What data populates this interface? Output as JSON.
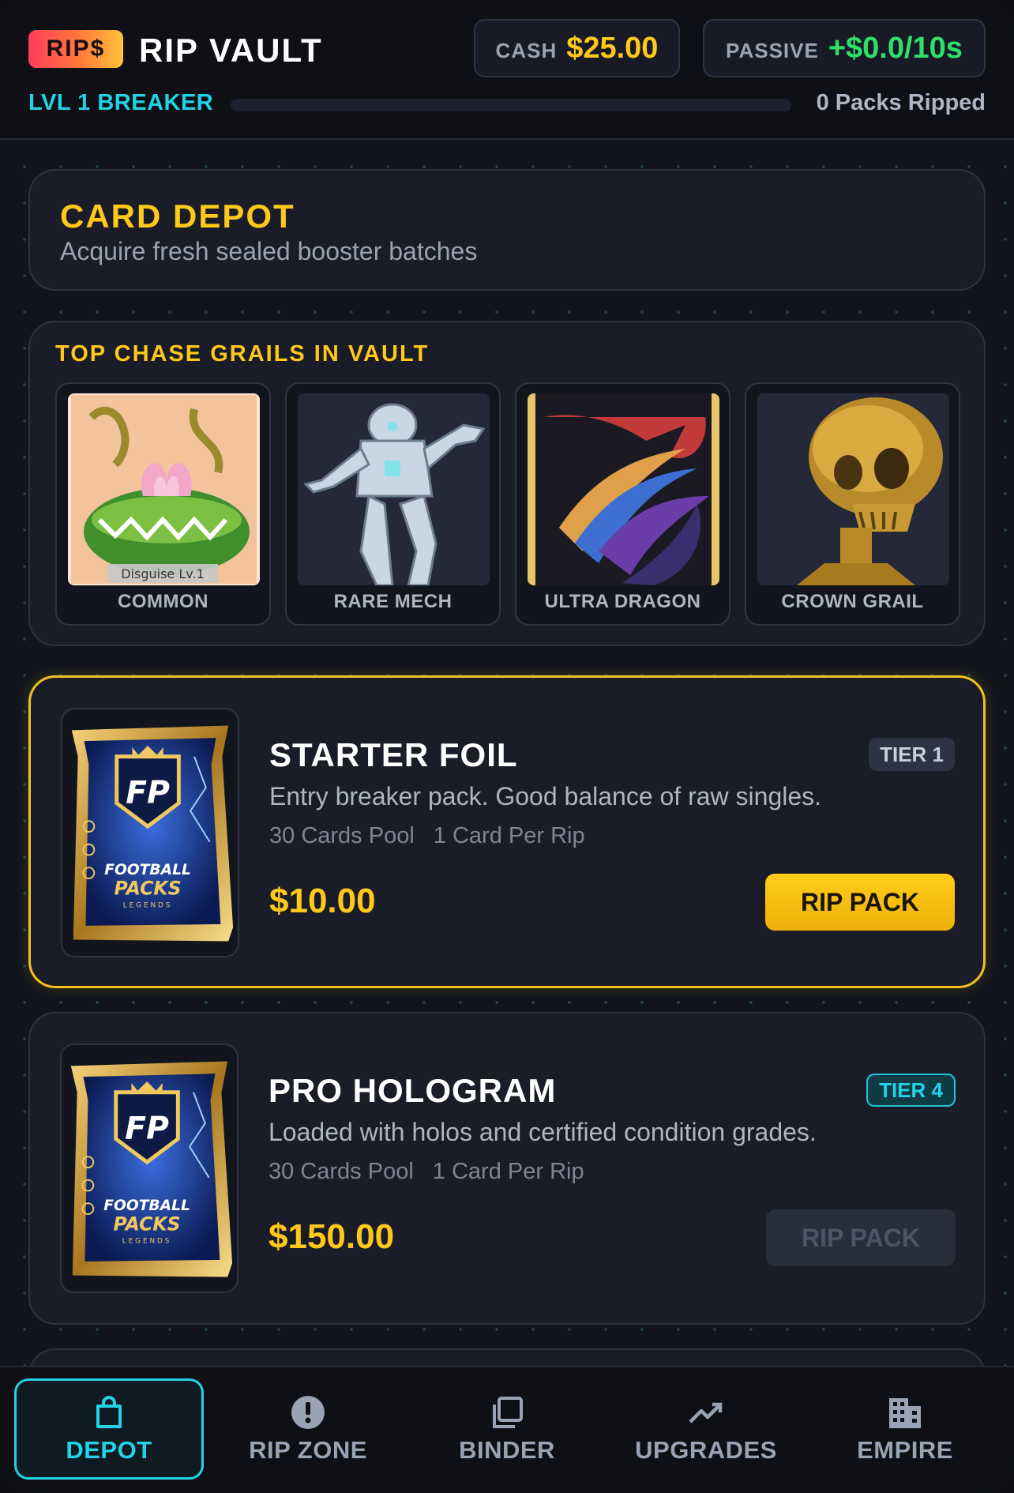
{
  "header": {
    "logo": "RIP$",
    "title": "RIP VAULT",
    "cash": {
      "label": "CASH",
      "value": "$25.00"
    },
    "passive": {
      "label": "PASSIVE",
      "value": "+$0.0/10s"
    },
    "level": "LVL 1 BREAKER",
    "xp_progress": 0,
    "packs_ripped": "0 Packs Ripped"
  },
  "depot": {
    "title": "CARD DEPOT",
    "subtitle": "Acquire fresh sealed booster batches"
  },
  "grails": {
    "title": "TOP CHASE GRAILS IN VAULT",
    "items": [
      {
        "label": "COMMON",
        "art": "flower-monster-card-art",
        "art_caption": "Disguise Lv.1"
      },
      {
        "label": "RARE MECH",
        "art": "mech-robot-art"
      },
      {
        "label": "ULTRA DRAGON",
        "art": "dragon-art"
      },
      {
        "label": "CROWN GRAIL",
        "art": "golden-skull-art"
      }
    ]
  },
  "packs": [
    {
      "name": "STARTER FOIL",
      "tier": "TIER 1",
      "description": "Entry breaker pack. Good balance of raw singles.",
      "pool": "30 Cards Pool",
      "per_rip": "1 Card Per Rip",
      "price": "$10.00",
      "button": "RIP PACK",
      "button_enabled": true,
      "selected": true,
      "pack_art": {
        "line1": "FOOTBALL",
        "line2": "PACKS",
        "line3": "LEGENDS",
        "monogram": "FP"
      }
    },
    {
      "name": "PRO HOLOGRAM",
      "tier": "TIER 4",
      "description": "Loaded with holos and certified condition grades.",
      "pool": "30 Cards Pool",
      "per_rip": "1 Card Per Rip",
      "price": "$150.00",
      "button": "RIP PACK",
      "button_enabled": false,
      "selected": false,
      "pack_art": {
        "line1": "FOOTBALL",
        "line2": "PACKS",
        "line3": "LEGENDS",
        "monogram": "FP"
      }
    }
  ],
  "nav": [
    {
      "label": "DEPOT",
      "icon": "shopping-bag-icon",
      "active": true
    },
    {
      "label": "RIP ZONE",
      "icon": "alert-circle-icon",
      "active": false
    },
    {
      "label": "BINDER",
      "icon": "card-stack-icon",
      "active": false
    },
    {
      "label": "UPGRADES",
      "icon": "trending-up-icon",
      "active": false
    },
    {
      "label": "EMPIRE",
      "icon": "building-icon",
      "active": false
    }
  ],
  "colors": {
    "accent_gold": "#ffc81a",
    "accent_cyan": "#22d3e6",
    "passive_green": "#2ee06b",
    "panel_bg": "#1a1d27"
  }
}
